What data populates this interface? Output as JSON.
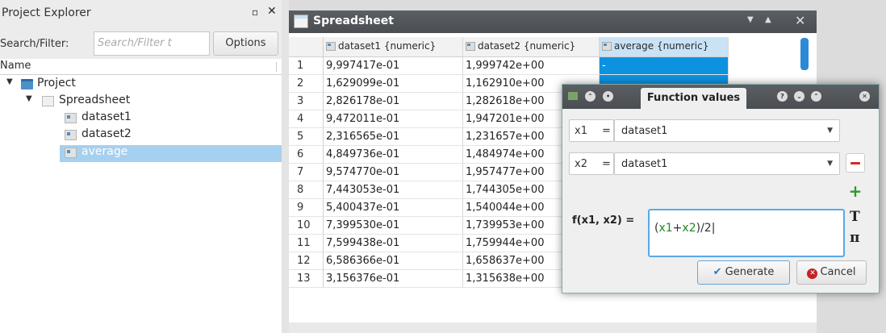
{
  "explorer": {
    "title": "Project Explorer",
    "float_icon": "▫",
    "close_icon": "✕",
    "search_label": "Search/Filter:",
    "search_placeholder": "Search/Filter t",
    "options_label": "Options",
    "column_header": "Name",
    "tree": [
      {
        "label": "Project",
        "level": 0,
        "icon": "folder-icon",
        "expanded": true
      },
      {
        "label": "Spreadsheet",
        "level": 1,
        "icon": "spreadsheet-icon",
        "expanded": true
      },
      {
        "label": "dataset1",
        "level": 2,
        "icon": "column-icon"
      },
      {
        "label": "dataset2",
        "level": 2,
        "icon": "column-icon"
      },
      {
        "label": "average",
        "level": 2,
        "icon": "column-icon",
        "selected": true
      }
    ]
  },
  "spreadsheet": {
    "title": "Spreadsheet",
    "columns": [
      "dataset1 {numeric}",
      "dataset2 {numeric}",
      "average {numeric}"
    ],
    "rows": [
      {
        "n": "1",
        "a": "9,997417e-01",
        "b": "1,999742e+00",
        "c": "-"
      },
      {
        "n": "2",
        "a": "1,629099e-01",
        "b": "1,162910e+00",
        "c": ""
      },
      {
        "n": "3",
        "a": "2,826178e-01",
        "b": "1,282618e+00",
        "c": ""
      },
      {
        "n": "4",
        "a": "9,472011e-01",
        "b": "1,947201e+00",
        "c": ""
      },
      {
        "n": "5",
        "a": "2,316565e-01",
        "b": "1,231657e+00",
        "c": ""
      },
      {
        "n": "6",
        "a": "4,849736e-01",
        "b": "1,484974e+00",
        "c": ""
      },
      {
        "n": "7",
        "a": "9,574770e-01",
        "b": "1,957477e+00",
        "c": ""
      },
      {
        "n": "8",
        "a": "7,443053e-01",
        "b": "1,744305e+00",
        "c": ""
      },
      {
        "n": "9",
        "a": "5,400437e-01",
        "b": "1,540044e+00",
        "c": ""
      },
      {
        "n": "10",
        "a": "7,399530e-01",
        "b": "1,739953e+00",
        "c": ""
      },
      {
        "n": "11",
        "a": "7,599438e-01",
        "b": "1,759944e+00",
        "c": ""
      },
      {
        "n": "12",
        "a": "6,586366e-01",
        "b": "1,658637e+00",
        "c": ""
      },
      {
        "n": "13",
        "a": "3,156376e-01",
        "b": "1,315638e+00",
        "c": "-"
      }
    ]
  },
  "dialog": {
    "tab_title": "Function values",
    "var1": {
      "name": "x1",
      "eq": "=",
      "value": "dataset1"
    },
    "var2": {
      "name": "x2",
      "eq": "=",
      "value": "dataset1"
    },
    "function_label": "f(x1, x2) =",
    "expr_open": "(",
    "expr_v1": "x1",
    "expr_plus": "+",
    "expr_v2": "x2",
    "expr_rest": ")/2",
    "generate_label": "Generate",
    "cancel_label": "Cancel",
    "text_tool_icon": "T",
    "pi_tool_icon": "π"
  },
  "colors": {
    "selection": "#0d92e0",
    "accent": "#2b8ad8",
    "danger": "#d42a2a",
    "add": "#2c9a2c"
  }
}
